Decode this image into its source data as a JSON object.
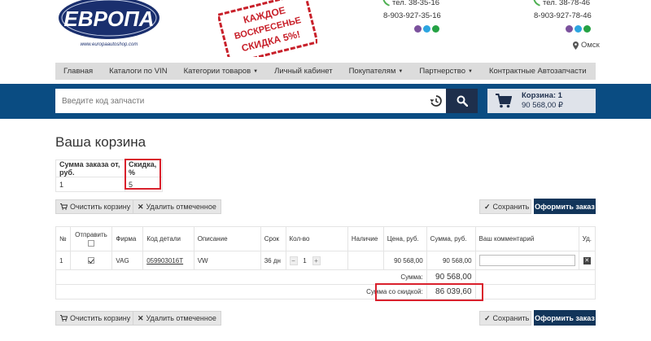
{
  "header": {
    "logo_text": "ЕВРОПА",
    "logo_sub": "www.europaautoshop.com",
    "stamp_lines": [
      "КАЖДОЕ",
      "ВОСКРЕСЕНЬЕ",
      "СКИДКА 5%!"
    ],
    "contact_left": {
      "phone1": "тел. 38-35-16",
      "phone2": "8-903-927-35-16"
    },
    "contact_right": {
      "phone1": "тел. 38-78-46",
      "phone2": "8-903-927-78-46"
    },
    "city": "Омск"
  },
  "nav": {
    "items": [
      {
        "label": "Главная",
        "has_caret": false
      },
      {
        "label": "Каталоги по VIN",
        "has_caret": false
      },
      {
        "label": "Категории товаров",
        "has_caret": true
      },
      {
        "label": "Личный кабинет",
        "has_caret": false
      },
      {
        "label": "Покупателям",
        "has_caret": true
      },
      {
        "label": "Партнерство",
        "has_caret": true
      },
      {
        "label": "Контрактные Автозапчасти",
        "has_caret": false
      }
    ]
  },
  "search": {
    "placeholder": "Введите код запчасти"
  },
  "cart": {
    "title": "Корзина: 1",
    "total": "90 568,00 ₽"
  },
  "page": {
    "title": "Ваша корзина"
  },
  "discount": {
    "col1_header": "Сумма заказа от, руб.",
    "col2_header": "Скидка, %",
    "col1_value": "1",
    "col2_value": "5"
  },
  "actions": {
    "clear": "Очистить корзину",
    "delete_selected": "Удалить отмеченное",
    "save": "Сохранить",
    "checkout": "Оформить заказ"
  },
  "items_table": {
    "headers": {
      "num": "№",
      "send": "Отправить",
      "brand": "Фирма",
      "code": "Код детали",
      "desc": "Описание",
      "term": "Срок",
      "qty": "Кол-во",
      "avail": "Наличие",
      "price": "Цена, руб.",
      "sum": "Сумма, руб.",
      "comment": "Ваш комментарий",
      "del": "Уд."
    },
    "rows": [
      {
        "num": "1",
        "brand": "VAG",
        "code": "059903016T",
        "desc": "VW",
        "term": "36 дн",
        "qty": "1",
        "avail": "",
        "price": "90 568,00",
        "sum": "90 568,00"
      }
    ],
    "sum_label": "Сумма:",
    "sum_value": "90 568,00",
    "discount_sum_label": "Сумма со скидкой:",
    "discount_sum_value": "86 039,60"
  },
  "colors": {
    "nav_bg": "#dcdcdc",
    "band_bg": "#0a4c82",
    "dark_btn": "#12355a",
    "highlight_red": "#d9202c"
  }
}
